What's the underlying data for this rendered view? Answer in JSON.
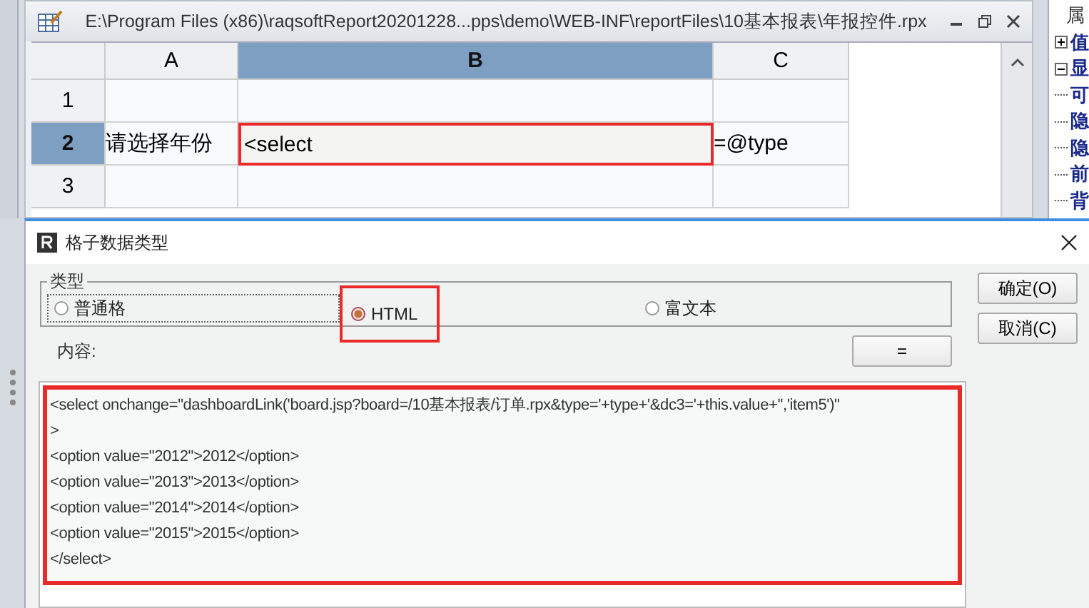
{
  "editor": {
    "title": "E:\\Program Files (x86)\\raqsoftReport20201228...pps\\demo\\WEB-INF\\reportFiles\\10基本报表\\年报控件.rpx",
    "columns": [
      {
        "label": "A",
        "selected": false
      },
      {
        "label": "B",
        "selected": true
      },
      {
        "label": "C",
        "selected": false
      }
    ],
    "rows": [
      {
        "label": "1",
        "selected": false
      },
      {
        "label": "2",
        "selected": true,
        "cells": [
          {
            "text": "请选择年份",
            "highlighted": false
          },
          {
            "text": "<select",
            "highlighted": true
          },
          {
            "text": "=@type",
            "highlighted": false
          }
        ]
      },
      {
        "label": "3",
        "selected": false
      }
    ]
  },
  "properties_panel": {
    "items": [
      {
        "text": "属",
        "kind": "header"
      },
      {
        "text": "值",
        "kind": "collapsed"
      },
      {
        "text": "显",
        "kind": "expanded"
      },
      {
        "text": "可",
        "kind": "leaf"
      },
      {
        "text": "隐",
        "kind": "leaf"
      },
      {
        "text": "隐",
        "kind": "leaf"
      },
      {
        "text": "前",
        "kind": "leaf"
      },
      {
        "text": "背",
        "kind": "leaf"
      }
    ]
  },
  "dialog": {
    "title": "格子数据类型",
    "group_label": "类型",
    "types": [
      {
        "label": "普通格",
        "selected": false,
        "highlighted": false
      },
      {
        "label": "HTML",
        "selected": true,
        "highlighted": true
      },
      {
        "label": "富文本",
        "selected": false,
        "highlighted": false
      }
    ],
    "buttons": [
      "确定(O)",
      "取消(C)"
    ],
    "content_label": "内容:",
    "insert_button": "=",
    "content": {
      "highlighted": true,
      "lines": [
        "<select onchange=\"dashboardLink('board.jsp?board=/10基本报表/订单.rpx&type='+type+'&dc3='+this.value+'','item5')\"",
        ">",
        "<option value=\"2012\">2012</option>",
        "<option value=\"2013\">2013</option>",
        "<option value=\"2014\">2014</option>",
        "<option value=\"2015\">2015</option>",
        "</select>"
      ]
    }
  }
}
